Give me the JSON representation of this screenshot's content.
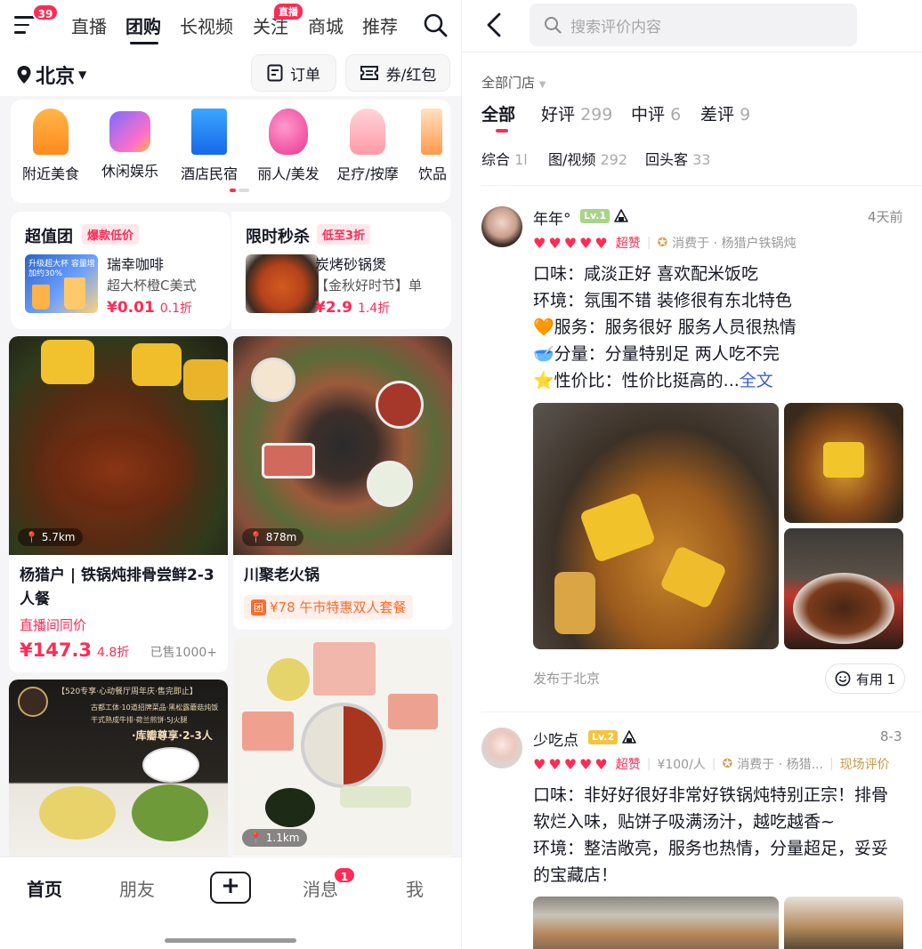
{
  "left": {
    "header": {
      "menu_badge": "39",
      "tabs": [
        {
          "label": "直播",
          "active": false
        },
        {
          "label": "团购",
          "active": true
        },
        {
          "label": "长视频",
          "active": false
        },
        {
          "label": "关注",
          "active": false
        },
        {
          "label": "商城",
          "active": false
        },
        {
          "label": "推荐",
          "active": false
        }
      ],
      "live_tag": "直播",
      "icons": {
        "menu": "menu-icon",
        "search": "search-icon"
      }
    },
    "location": {
      "city": "北京",
      "orders_label": "订单",
      "coupons_label": "券/红包"
    },
    "categories": [
      {
        "label": "附近美食",
        "icon": "food-icon"
      },
      {
        "label": "休闲娱乐",
        "icon": "entertainment-icon"
      },
      {
        "label": "酒店民宿",
        "icon": "hotel-icon"
      },
      {
        "label": "丽人/美发",
        "icon": "beauty-icon"
      },
      {
        "label": "足疗/按摩",
        "icon": "massage-icon"
      },
      {
        "label": "饮品",
        "icon": "drink-icon"
      }
    ],
    "promos": [
      {
        "title": "超值团",
        "tag": "爆款低价",
        "name": "瑞幸咖啡",
        "sub": "超大杯橙C美式",
        "price": "¥0.01",
        "discount": "0.1折",
        "thumb_text": "升级超大杯 容量增加约30%"
      },
      {
        "title": "限时秒杀",
        "tag": "低至3折",
        "name": "炭烤砂锅煲",
        "sub": "【金秋好时节】单",
        "price": "¥2.9",
        "discount": "1.4折"
      }
    ],
    "cards": [
      {
        "distance": "5.7km",
        "title": "杨猎户 | 铁锅炖排骨尝鲜2-3人餐",
        "note": "直播间同价",
        "price": "¥147.3",
        "discount": "4.8折",
        "sold": "已售1000+"
      },
      {
        "distance": "878m",
        "title": "川聚老火锅",
        "coupon_icon": "团",
        "coupon": "¥78 午市特惠双人套餐"
      },
      {
        "distance": "",
        "banner": "【520专享·心动餐厅周年庆·售完即止】",
        "banner_sub": "古都工体·10道招牌菜品·黑松露蘑菇炖饭",
        "banner_sub2": "干式熟成牛排·荷兰煎饼·5J火腿",
        "banner_people": "·库瓣尊享·2-3人"
      },
      {
        "distance": "1.1km"
      }
    ],
    "bottom_nav": [
      {
        "label": "首页",
        "active": true
      },
      {
        "label": "朋友",
        "active": false
      },
      {
        "label": "+",
        "active": false
      },
      {
        "label": "消息",
        "active": false,
        "badge": "1"
      },
      {
        "label": "我",
        "active": false
      }
    ]
  },
  "right": {
    "search": {
      "placeholder": "搜索评价内容"
    },
    "store_filter": "全部门店",
    "filter_tabs": [
      {
        "label": "全部",
        "count": "",
        "active": true
      },
      {
        "label": "好评",
        "count": "299",
        "active": false
      },
      {
        "label": "中评",
        "count": "6",
        "active": false
      },
      {
        "label": "差评",
        "count": "9",
        "active": false
      }
    ],
    "sort_tabs": [
      {
        "label": "综合",
        "count": "1l"
      },
      {
        "label": "图/视频",
        "count": "292"
      },
      {
        "label": "回头客",
        "count": "33"
      }
    ],
    "reviews": [
      {
        "user": "年年°",
        "level": "Lv.1",
        "time": "4天前",
        "rating_label": "超赞",
        "spent_at": "消费于 · 杨猎户铁锅炖",
        "lines": [
          "口味：咸淡正好 喜欢配米饭吃",
          "环境：氛围不错 装修很有东北特色",
          "🧡服务：服务很好 服务人员很热情",
          "🥣分量：分量特别足 两人吃不完",
          "⭐性价比：性价比挺高的..."
        ],
        "more": "全文",
        "published_in": "发布于北京",
        "useful_label": "有用 1"
      },
      {
        "user": "少吃点",
        "level": "Lv.2",
        "time": "8-3",
        "rating_label": "超赞",
        "price_per": "¥100/人",
        "spent_at": "消费于 · 杨猎...",
        "tag": "现场评价",
        "lines": [
          "口味：非好好很好非常好铁锅炖特别正宗！排骨软烂入味，贴饼子吸满汤汁，越吃越香~",
          "环境：整洁敞亮，服务也热情，分量超足，妥妥的宝藏店！"
        ]
      }
    ]
  }
}
